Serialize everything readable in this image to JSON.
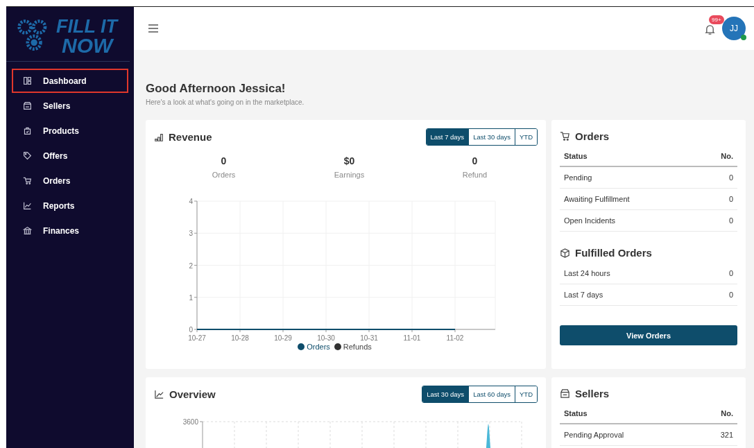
{
  "logo": {
    "line_1": "FILL IT",
    "line_2": "NOW"
  },
  "sidebar": {
    "items": [
      {
        "label": "Dashboard",
        "selected": true
      },
      {
        "label": "Sellers",
        "selected": false
      },
      {
        "label": "Products",
        "selected": false
      },
      {
        "label": "Offers",
        "selected": false
      },
      {
        "label": "Orders",
        "selected": false
      },
      {
        "label": "Reports",
        "selected": false
      },
      {
        "label": "Finances",
        "selected": false
      }
    ]
  },
  "header": {
    "notification_badge": "99+",
    "avatar": {
      "initials": "JJ",
      "online": true
    }
  },
  "greeting": {
    "title": "Good Afternoon Jessica!",
    "subtitle": "Here's a look at what's going on in the marketplace."
  },
  "revenue": {
    "title": "Revenue",
    "ranges": [
      {
        "label": "Last 7 days",
        "selected": true
      },
      {
        "label": "Last 30 days",
        "selected": false
      },
      {
        "label": "YTD",
        "selected": false
      }
    ],
    "stats": [
      {
        "value": "0",
        "label": "Orders"
      },
      {
        "value": "$0",
        "label": "Earnings"
      },
      {
        "value": "0",
        "label": "Refund"
      }
    ],
    "chart_data": {
      "type": "line",
      "categories": [
        "10-27",
        "10-28",
        "10-29",
        "10-30",
        "10-31",
        "11-01",
        "11-02"
      ],
      "ylim": [
        0,
        4
      ],
      "grid": true,
      "legend": true,
      "yticks": [
        0,
        1,
        2,
        3,
        4
      ],
      "series": [
        {
          "name": "Orders",
          "color": "#0e4d6b",
          "values": [
            0,
            0,
            0,
            0,
            0,
            0,
            0
          ]
        },
        {
          "name": "Refunds",
          "color": "#333333",
          "values": [
            null,
            null,
            null,
            null,
            null,
            null,
            null
          ]
        }
      ]
    }
  },
  "orders": {
    "title": "Orders",
    "columns": [
      "Status",
      "No."
    ],
    "rows": [
      [
        "Pending",
        "0"
      ],
      [
        "Awaiting Fulfillment",
        "0"
      ],
      [
        "Open Incidents",
        "0"
      ]
    ],
    "fulfilled_title": "Fulfilled Orders",
    "fulfilled_rows": [
      [
        "Last 24 hours",
        "0"
      ],
      [
        "Last 7 days",
        "0"
      ]
    ],
    "button": "View Orders"
  },
  "overview": {
    "title": "Overview",
    "ranges": [
      {
        "label": "Last 30 days",
        "selected": true
      },
      {
        "label": "Last 60 days",
        "selected": false
      },
      {
        "label": "YTD",
        "selected": false
      }
    ],
    "y_tick_label": "3600"
  },
  "sellers": {
    "title": "Sellers",
    "columns": [
      "Status",
      "No."
    ],
    "rows": [
      [
        "Pending Approval",
        "321"
      ]
    ]
  }
}
